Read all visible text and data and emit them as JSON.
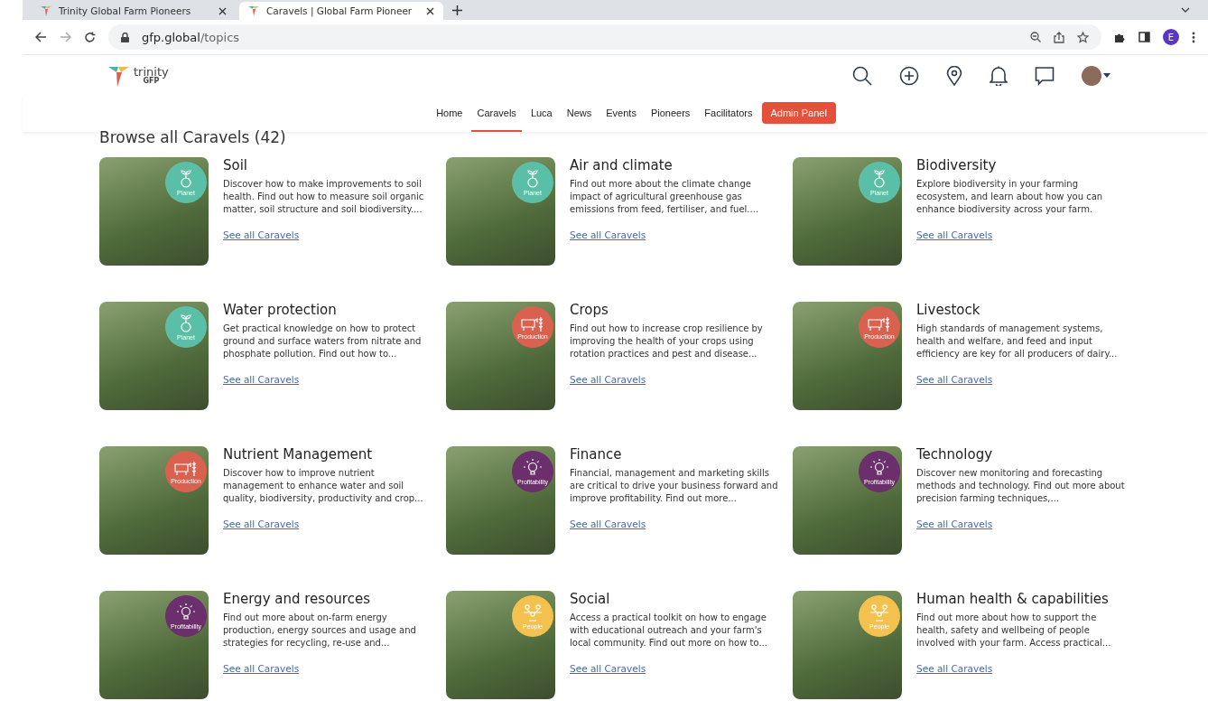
{
  "browser": {
    "tabs": [
      {
        "title": "Trinity Global Farm Pioneers",
        "selected": false
      },
      {
        "title": "Caravels | Global Farm Pioneer",
        "selected": true
      }
    ],
    "address": {
      "host": "gfp.global",
      "path": "/topics"
    },
    "profile_initial": "E"
  },
  "site": {
    "logo": {
      "name": "trinity",
      "sub": "GFP"
    },
    "nav": [
      {
        "label": "Home",
        "selected": false,
        "kind": "link"
      },
      {
        "label": "Caravels",
        "selected": true,
        "kind": "link"
      },
      {
        "label": "Luca",
        "selected": false,
        "kind": "link"
      },
      {
        "label": "News",
        "selected": false,
        "kind": "link"
      },
      {
        "label": "Events",
        "selected": false,
        "kind": "link"
      },
      {
        "label": "Pioneers",
        "selected": false,
        "kind": "link"
      },
      {
        "label": "Facilitators",
        "selected": false,
        "kind": "link"
      },
      {
        "label": "Admin Panel",
        "selected": false,
        "kind": "admin"
      }
    ]
  },
  "heading": "Browse all Caravels (42)",
  "topics": [
    {
      "title": "Soil",
      "category": "Planet",
      "kind": "planet",
      "color": "#5bbfa8",
      "description": "Discover how to make improvements to soil health. Find out how to measure soil organic matter, soil structure and soil biodiversity....",
      "link": "See all Caravels"
    },
    {
      "title": "Air and climate",
      "category": "Planet",
      "kind": "planet",
      "color": "#5bbfa8",
      "description": "Find out more about the climate change impact of agricultural greenhouse gas emissions from feed, fertiliser, and fuel....",
      "link": "See all Caravels"
    },
    {
      "title": "Biodiversity",
      "category": "Planet",
      "kind": "planet",
      "color": "#5bbfa8",
      "description": "Explore biodiversity in your farming ecosystem, and learn about how you can enhance biodiversity across your farm.",
      "link": "See all Caravels"
    },
    {
      "title": "Water protection",
      "category": "Planet",
      "kind": "planet",
      "color": "#5bbfa8",
      "description": "Get practical knowledge on how to protect ground and surface waters from nitrate and phosphate pollution. Find out how to...",
      "link": "See all Caravels"
    },
    {
      "title": "Crops",
      "category": "Production",
      "kind": "production",
      "color": "#d9614f",
      "description": "Find out how to increase crop resilience by improving the health of your crops using rotation practices and pest and disease...",
      "link": "See all Caravels"
    },
    {
      "title": "Livestock",
      "category": "Production",
      "kind": "production",
      "color": "#d9614f",
      "description": "High standards of management systems, health and welfare, and feed and input efficiency are key for all producers of dairy...",
      "link": "See all Caravels"
    },
    {
      "title": "Nutrient Management",
      "category": "Production",
      "kind": "production",
      "color": "#d9614f",
      "description": "Discover how to improve nutrient management to enhance water and soil quality, biodiversity, productivity and crop...",
      "link": "See all Caravels"
    },
    {
      "title": "Finance",
      "category": "Profitability",
      "kind": "profitability",
      "color": "#6b2f6b",
      "description": "Financial, management and marketing skills are critical to drive your business forward and improve profitability. Find out more...",
      "link": "See all Caravels"
    },
    {
      "title": "Technology",
      "category": "Profitability",
      "kind": "profitability",
      "color": "#6b2f6b",
      "description": "Discover new monitoring and forecasting methods and technology. Find out more about precision farming techniques,...",
      "link": "See all Caravels"
    },
    {
      "title": "Energy and resources",
      "category": "Profitability",
      "kind": "profitability",
      "color": "#6b2f6b",
      "description": "Find out more about on-farm energy production, energy sources and usage and strategies for recycling, re-use and...",
      "link": "See all Caravels"
    },
    {
      "title": "Social",
      "category": "People",
      "kind": "people",
      "color": "#f2c14e",
      "description": "Access a practical toolkit on how to engage with educational outreach and your farm's local community. Find out more on how to...",
      "link": "See all Caravels"
    },
    {
      "title": "Human health & capabilities",
      "category": "People",
      "kind": "people",
      "color": "#f2c14e",
      "description": "Find out more about how to support the health, safety and wellbeing of people involved with your farm. Access practical...",
      "link": "See all Caravels"
    }
  ]
}
